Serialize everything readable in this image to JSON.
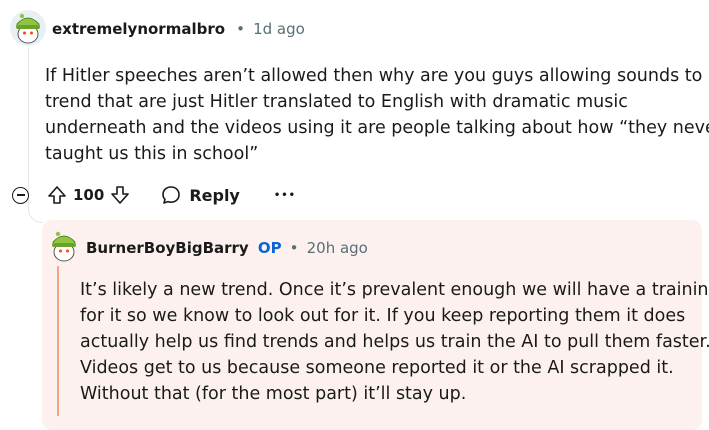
{
  "colors": {
    "accent_blue": "#0a65d1",
    "reply_background": "#fcf1ee",
    "reply_accent": "#f4a583",
    "meta_gray": "#576f76"
  },
  "comment": {
    "username": "extremelynormalbro",
    "separator": "•",
    "time": "1d ago",
    "body_lines": [
      "If Hitler speeches aren’t allowed then why are you guys allowing sounds to",
      "trend that are just Hitler translated to English with dramatic music",
      "underneath and the videos using it are people talking about how “they never",
      "taught us this in school”"
    ],
    "votes": "100",
    "reply_label": "Reply",
    "more_label": "•••",
    "icons": [
      "collapse-icon",
      "upvote-icon",
      "downvote-icon",
      "comment-icon",
      "more-icon"
    ]
  },
  "reply": {
    "username": "BurnerBoyBigBarry",
    "op_badge": "OP",
    "separator": "•",
    "time": "20h ago",
    "body_lines": [
      "It’s likely a new trend. Once it’s prevalent enough we will have a training",
      "for it so we know to look out for it. If you keep reporting them it does",
      "actually help us find trends and helps us train the AI to pull them faster.",
      "Videos get to us because someone reported it or the AI scrapped it.",
      "Without that (for the most part) it’ll stay up."
    ]
  }
}
